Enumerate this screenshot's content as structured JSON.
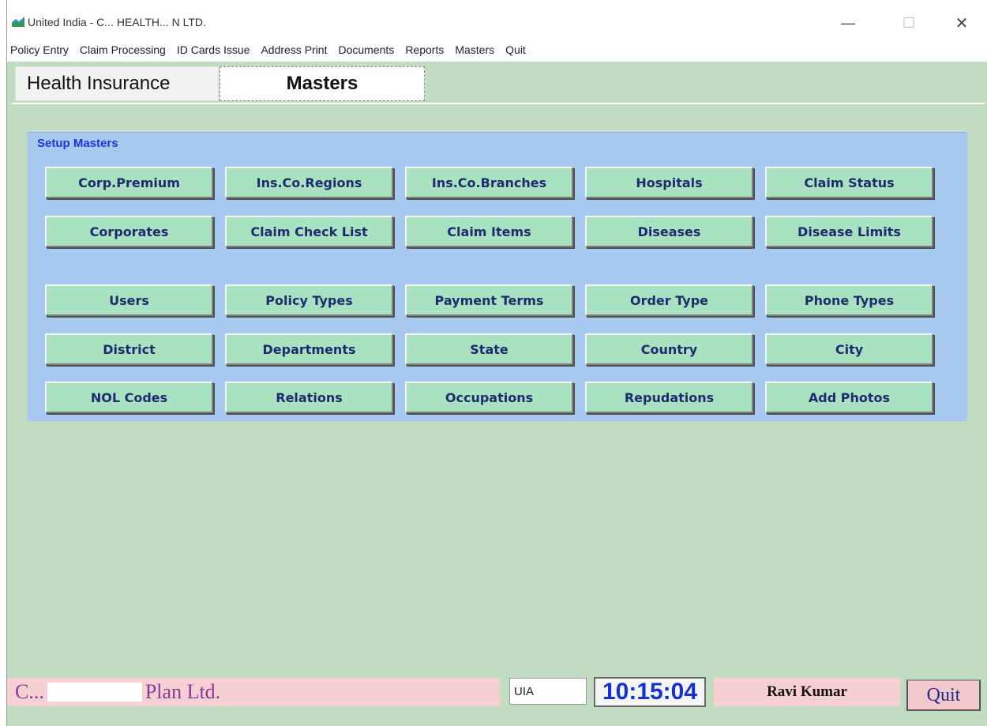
{
  "window": {
    "title": "United India - C... HEALTH... N LTD.",
    "icon": "app-chart-icon",
    "minimize_glyph": "—",
    "maximize_glyph": "☐",
    "close_glyph": "✕"
  },
  "menu": [
    "Policy Entry",
    "Claim Processing",
    "ID Cards Issue",
    "Address Print",
    "Documents",
    "Reports",
    "Masters",
    "Quit"
  ],
  "tabs": {
    "left": "Health Insurance",
    "active": "Masters"
  },
  "setup": {
    "title": "Setup Masters",
    "row1": [
      "Corp.Premium",
      "Ins.Co.Regions",
      "Ins.Co.Branches",
      "Hospitals",
      "Claim Status"
    ],
    "row2": [
      "Corporates",
      "Claim Check List",
      "Claim Items",
      "Diseases",
      "Disease Limits"
    ],
    "row3": [
      "Users",
      "Policy Types",
      "Payment Terms",
      "Order Type",
      "Phone Types"
    ],
    "row4": [
      "District",
      "Departments",
      "State",
      "Country",
      "City"
    ],
    "row5": [
      "NOL Codes",
      "Relations",
      "Occupations",
      "Repudations",
      "Add Photos"
    ]
  },
  "status": {
    "company_prefix": "C...",
    "company_suffix": "Plan Ltd.",
    "code": "UIA",
    "time": "10:15:04",
    "user": "Ravi Kumar",
    "quit": "Quit"
  },
  "colors": {
    "client_bg": "#c1dcc1",
    "panel_bg": "#a7c8ef",
    "button_bg": "#a8e2c0",
    "button_text": "#1e2b6e",
    "status_pink": "#f6cfd3",
    "time_blue": "#1530d8"
  }
}
